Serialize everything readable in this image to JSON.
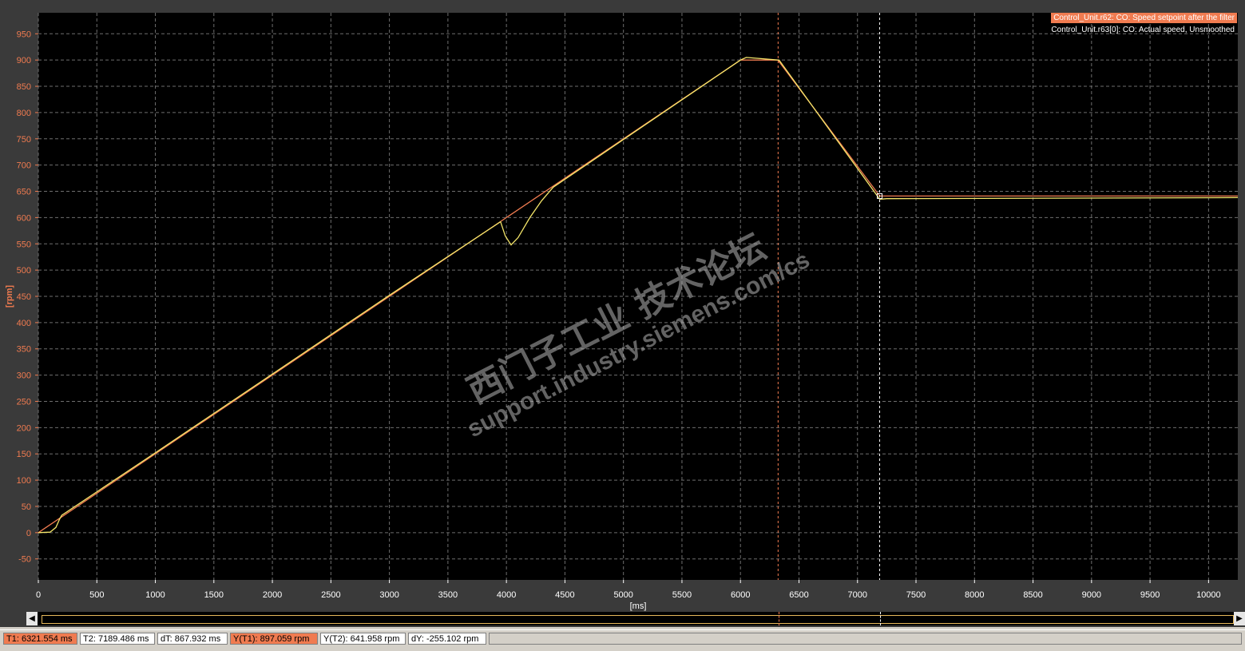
{
  "legend": {
    "series1": "Control_Unit.r62: CO: Speed setpoint after the filter",
    "series2": "Control_Unit.r63[0]: CO: Actual speed, Unsmoothed"
  },
  "colors": {
    "background": "#000000",
    "grid": "#6e6e6e",
    "setpoint": "#f07b50",
    "actual": "#f5e66a",
    "axis_labels": "#f07b50",
    "cursor1": "#f07b50",
    "cursor2": "#ffffff"
  },
  "watermark": {
    "line1": "西门子工业 技术论坛",
    "line2": "support.industry.siemens.com/cs"
  },
  "status": {
    "t1": "T1: 6321.554 ms",
    "t2": "T2: 7189.486 ms",
    "dt": "dT: 867.932 ms",
    "yt1": "Y(T1):  897.059 rpm",
    "yt2": "Y(T2): 641.958 rpm",
    "dy": "dY: -255.102 rpm"
  },
  "chart_data": {
    "type": "line",
    "xlabel": "[ms]",
    "ylabel": "[rpm]",
    "xlim": [
      0,
      10250
    ],
    "ylim": [
      -90,
      990
    ],
    "xticks": [
      0,
      500,
      1000,
      1500,
      2000,
      2500,
      3000,
      3500,
      4000,
      4500,
      5000,
      5500,
      6000,
      6500,
      7000,
      7500,
      8000,
      8500,
      9000,
      9500,
      10000
    ],
    "yticks": [
      -50,
      0,
      50,
      100,
      150,
      200,
      250,
      300,
      350,
      400,
      450,
      500,
      550,
      600,
      650,
      700,
      750,
      800,
      850,
      900,
      950
    ],
    "grid": true,
    "legend_position": "top-right",
    "cursors": [
      {
        "name": "T1",
        "x": 6321.554
      },
      {
        "name": "T2",
        "x": 7189.486
      }
    ],
    "series": [
      {
        "name": "Control_Unit.r62: CO: Speed setpoint after the filter",
        "x": [
          0,
          6000,
          6320,
          7190,
          10250
        ],
        "y": [
          0,
          900,
          900,
          641,
          641
        ]
      },
      {
        "name": "Control_Unit.r63[0]: CO: Actual speed, Unsmoothed",
        "x": [
          0,
          100,
          150,
          180,
          200,
          1000,
          2000,
          3000,
          3950,
          3990,
          4040,
          4100,
          4200,
          4300,
          4400,
          4500,
          6000,
          6050,
          6330,
          7190,
          7250,
          10250
        ],
        "y": [
          0,
          1,
          10,
          25,
          33,
          152,
          302,
          452,
          592,
          565,
          548,
          562,
          600,
          632,
          658,
          673,
          900,
          905,
          900,
          635,
          636,
          638
        ]
      }
    ]
  }
}
